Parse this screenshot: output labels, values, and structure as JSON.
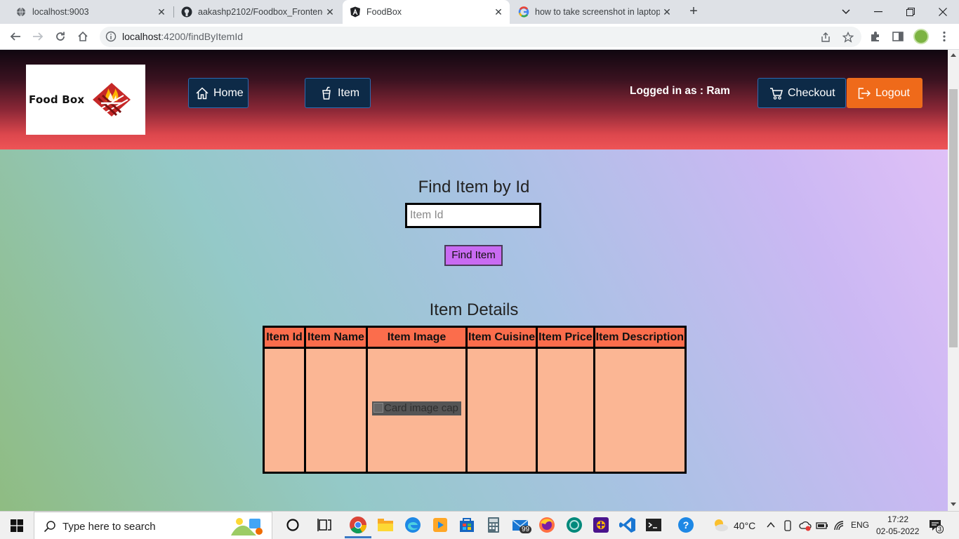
{
  "browser": {
    "tabs": [
      {
        "title": "localhost:9003",
        "icon": "globe-icon"
      },
      {
        "title": "aakashp2102/Foodbox_Frontend",
        "icon": "github-icon"
      },
      {
        "title": "FoodBox",
        "icon": "angular-icon",
        "active": true
      },
      {
        "title": "how to take screenshot in laptop",
        "icon": "google-icon"
      }
    ],
    "url_host": "localhost",
    "url_rest": ":4200/findByItemId"
  },
  "app": {
    "logo_text": "Food Box",
    "nav": {
      "home_label": "Home",
      "item_label": "Item",
      "checkout_label": "Checkout",
      "logout_label": "Logout"
    },
    "logged_in_text": "Logged in as : Ram",
    "find": {
      "title": "Find Item by Id",
      "placeholder": "Item Id",
      "button_label": "Find Item"
    },
    "details": {
      "title": "Item Details",
      "columns": [
        "Item Id",
        "Item Name",
        "Item Image",
        "Item Cuisine",
        "Item Price",
        "Item Description"
      ],
      "image_alt": "Card image cap"
    }
  },
  "taskbar": {
    "search_placeholder": "Type here to search",
    "weather": "40°C",
    "language": "ENG",
    "time": "17:22",
    "date": "02-05-2022",
    "mail_badge": "99",
    "notification_count": "3"
  },
  "colors": {
    "header_top": "#0f0710",
    "header_bottom": "#ee5456",
    "nav_button": "#0d2a47",
    "logout_button": "#ef6a1a",
    "find_button": "#c96bf2",
    "table_header": "#fb6d4c",
    "table_body": "#fbb694"
  }
}
